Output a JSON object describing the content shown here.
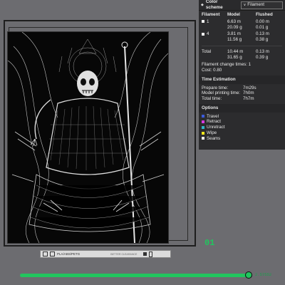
{
  "color_scheme": {
    "label": "Color scheme",
    "selected": "Filament"
  },
  "filament_table": {
    "headers": [
      "Filament",
      "Model",
      "Flushed"
    ],
    "rows": [
      {
        "id": "1",
        "color": "#f0f0f0",
        "model_len": "6.63 m",
        "model_wt": "20.09 g",
        "flushed_len": "0.00 m",
        "flushed_wt": "0.01 g"
      },
      {
        "id": "4",
        "color": "#f0f0f0",
        "model_len": "3.81 m",
        "model_wt": "11.56 g",
        "flushed_len": "0.13 m",
        "flushed_wt": "0.38 g"
      }
    ],
    "total": {
      "label": "Total",
      "model_len": "10.44 m",
      "model_wt": "31.65 g",
      "flushed_len": "0.13 m",
      "flushed_wt": "0.39 g"
    },
    "change_times": "Filament change times:  1",
    "cost": "Cost:  0.80"
  },
  "time_estimation": {
    "title": "Time Estimation",
    "prepare": {
      "label": "Prepare time:",
      "value": "7m29s"
    },
    "model_printing": {
      "label": "Model printing time:",
      "value": "7h0m"
    },
    "total": {
      "label": "Total time:",
      "value": "7h7m"
    }
  },
  "options": {
    "title": "Options",
    "items": [
      {
        "label": "Travel",
        "color": "#3b5bdb"
      },
      {
        "label": "Retract",
        "color": "#d63adf"
      },
      {
        "label": "Unretract",
        "color": "#2fb6c9"
      },
      {
        "label": "Wipe",
        "color": "#f5e61c"
      },
      {
        "label": "Seams",
        "color": "#e6e6e6"
      }
    ]
  },
  "plate_bar": {
    "label": "PLA/ABS/PETG",
    "note": "BETTER CLEARANCE"
  },
  "layer": {
    "current": "01",
    "slider_value": "2.57552",
    "progress_fraction": 0.98
  },
  "colors": {
    "accent_green": "#22c55e",
    "panel_bg": "#2c2c2e",
    "canvas_bg": "#6c6c70"
  }
}
